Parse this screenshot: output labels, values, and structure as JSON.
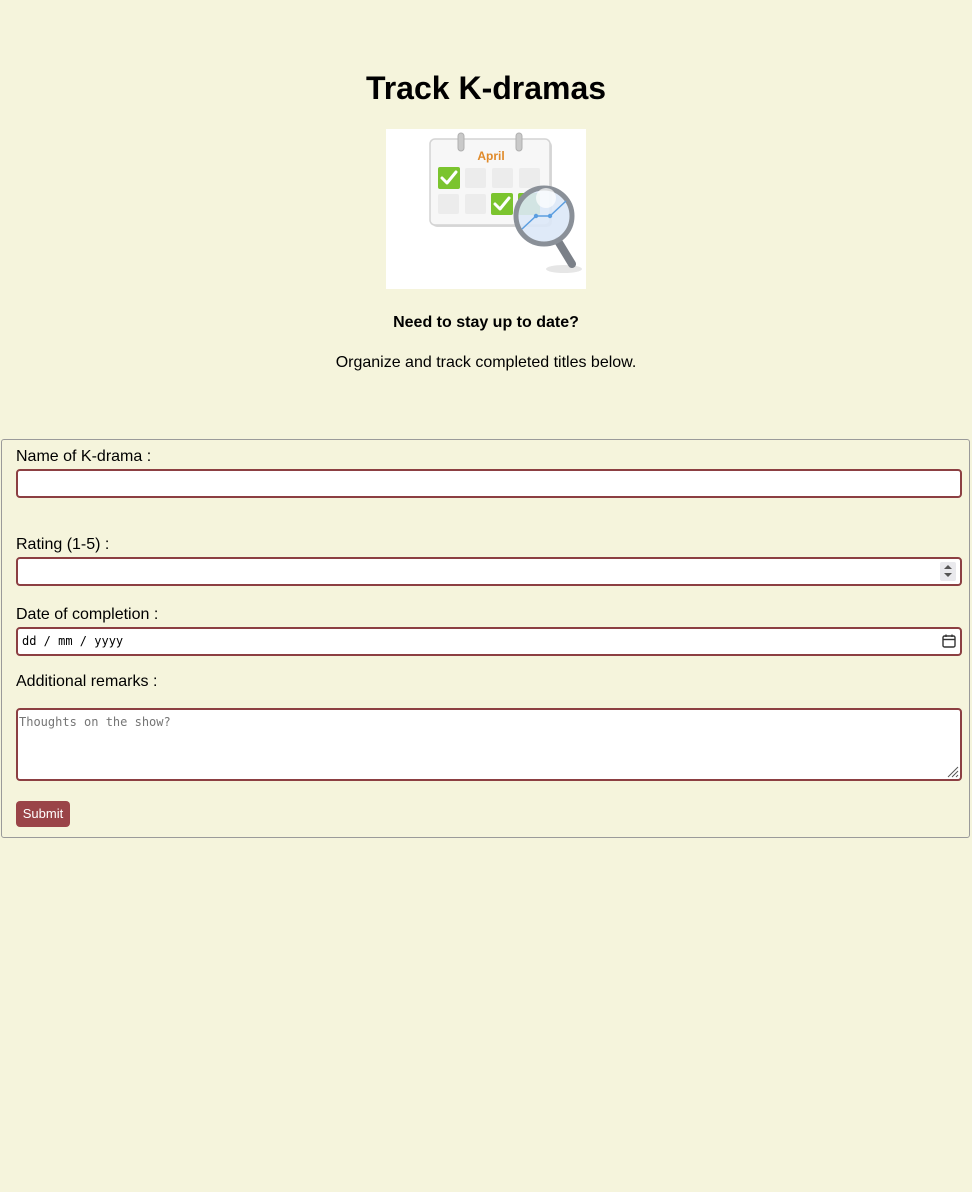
{
  "page": {
    "title": "Track K-dramas",
    "tagline": "Need to stay up to date?",
    "subtext": "Organize and track completed titles below."
  },
  "hero_image": {
    "icon": "calendar-magnifier-icon",
    "month_label": "April"
  },
  "form": {
    "name_label": "Name of K-drama :",
    "name_value": "",
    "rating_label": "Rating (1-5) :",
    "rating_value": "",
    "date_label": "Date of completion :",
    "date_placeholder": "dd / mm / yyyy",
    "remarks_label": "Additional remarks :",
    "remarks_placeholder": "Thoughts on the show?",
    "submit_label": "Submit"
  },
  "colors": {
    "background": "#f5f4dc",
    "input_border": "#8c3f42",
    "button": "#9a4448"
  }
}
